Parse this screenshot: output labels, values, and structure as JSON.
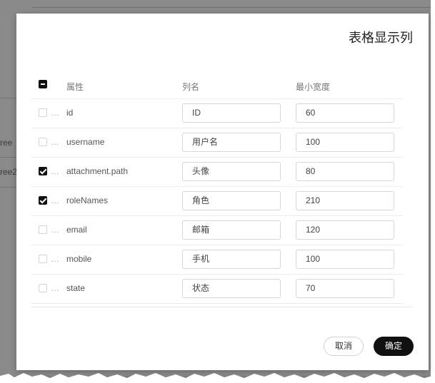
{
  "background": {
    "cells": [
      "ree",
      "ree2"
    ]
  },
  "dialog": {
    "title": "表格显示列",
    "columns": {
      "attribute": "属性",
      "column_name": "列名",
      "min_width": "最小宽度"
    },
    "rows": [
      {
        "prop": "id",
        "name": "ID",
        "width": "60",
        "checked": false
      },
      {
        "prop": "username",
        "name": "用户名",
        "width": "100",
        "checked": false
      },
      {
        "prop": "attachment.path",
        "name": "头像",
        "width": "80",
        "checked": true
      },
      {
        "prop": "roleNames",
        "name": "角色",
        "width": "210",
        "checked": true
      },
      {
        "prop": "email",
        "name": "邮箱",
        "width": "120",
        "checked": false
      },
      {
        "prop": "mobile",
        "name": "手机",
        "width": "100",
        "checked": false
      },
      {
        "prop": "state",
        "name": "状态",
        "width": "70",
        "checked": false
      }
    ],
    "ellipsis": "…",
    "cancel_label": "取消",
    "ok_label": "确定"
  },
  "colors": {
    "accent": "#111111",
    "overlay": "#7b7b7b"
  }
}
